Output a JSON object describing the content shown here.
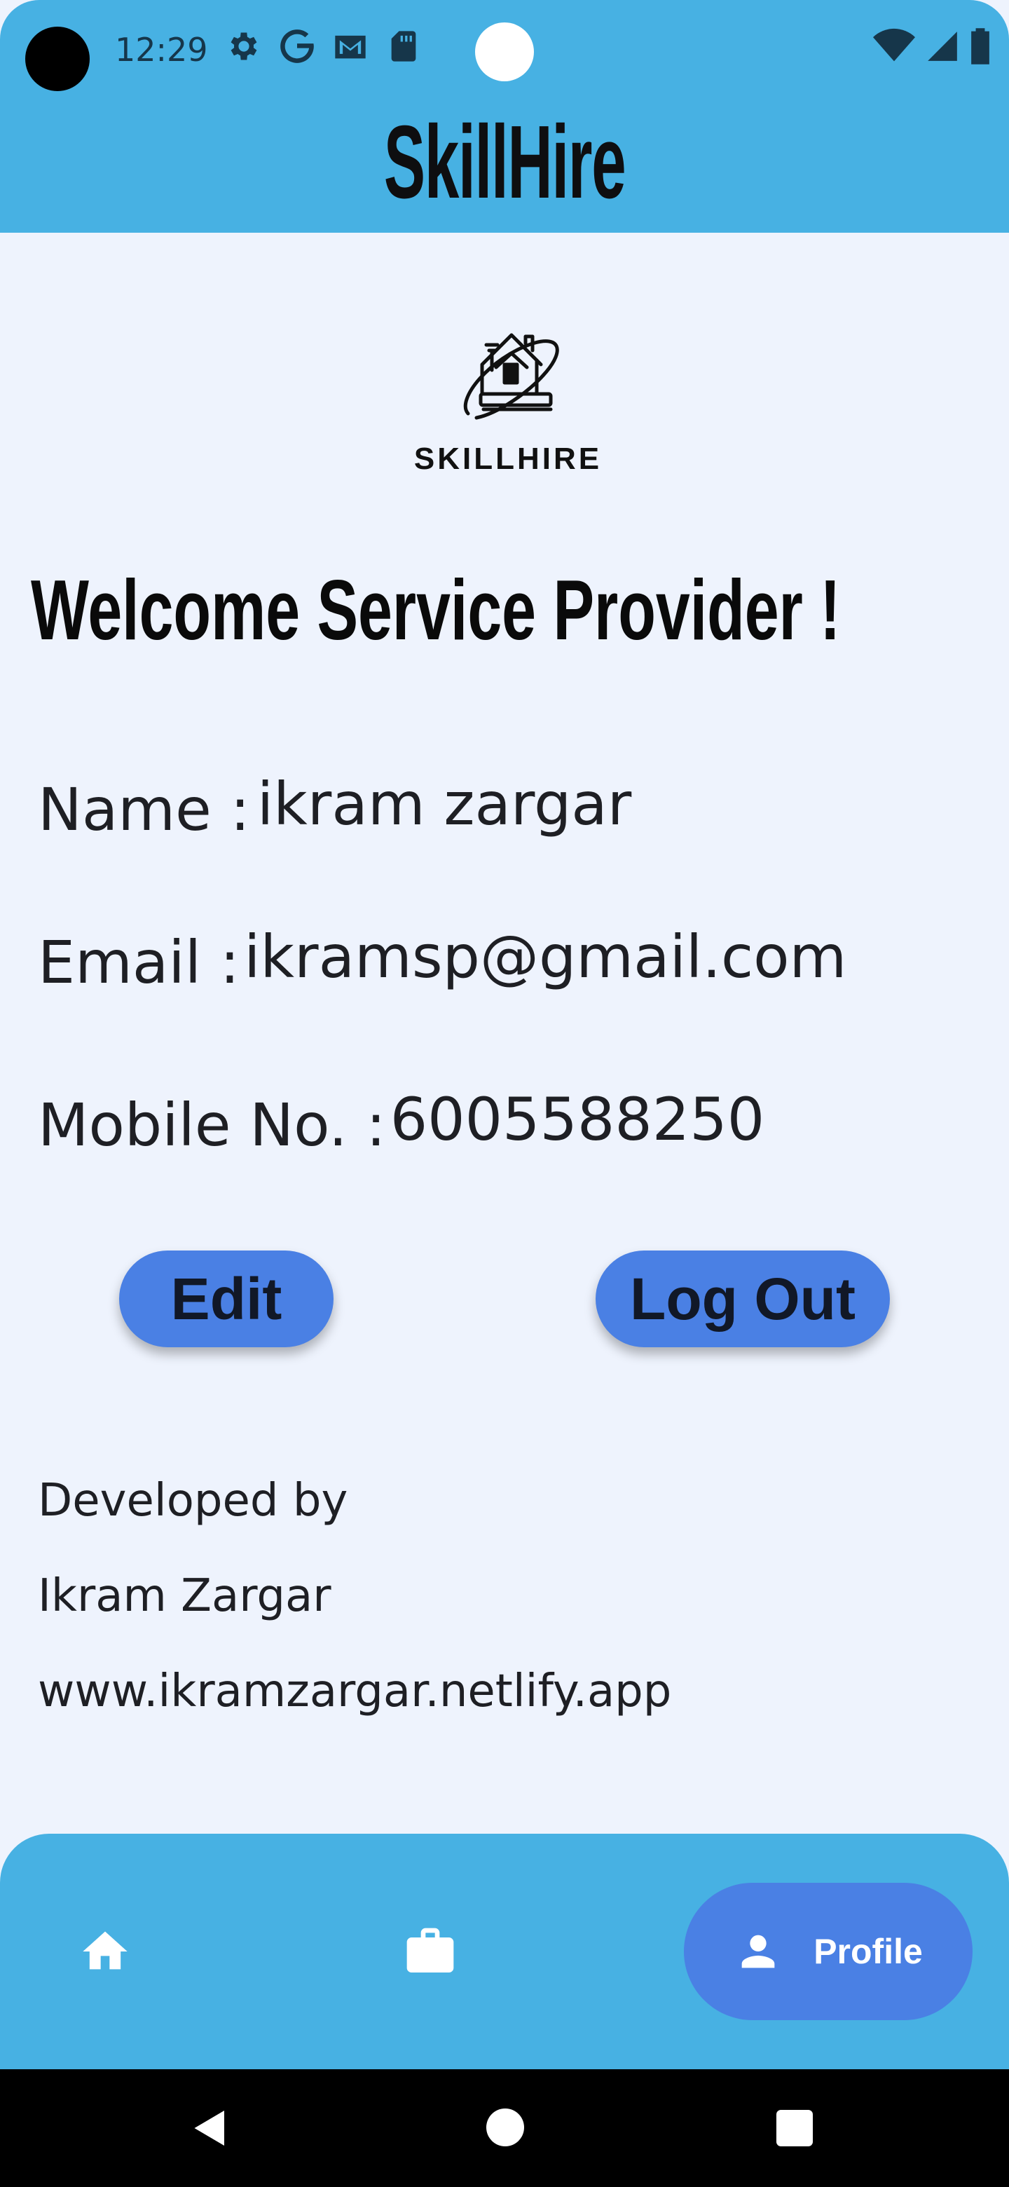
{
  "status_bar": {
    "time": "12:29",
    "icons": [
      "gear-icon",
      "google-g-icon",
      "gmail-icon",
      "sd-card-icon",
      "wifi-icon",
      "signal-icon",
      "battery-icon"
    ]
  },
  "app_bar": {
    "title": "SkillHire"
  },
  "logo": {
    "text": "SKILLHIRE"
  },
  "welcome": "Welcome Service Provider !",
  "profile": {
    "name_label": "Name : ",
    "name_value": "ikram zargar",
    "email_label": "Email : ",
    "email_value": "ikramsp@gmail.com",
    "mobile_label": "Mobile No. : ",
    "mobile_value": "6005588250"
  },
  "actions": {
    "edit": "Edit",
    "logout": "Log Out"
  },
  "developer": {
    "line1": "Developed by",
    "line2": "Ikram Zargar",
    "line3": "www.ikramzargar.netlify.app"
  },
  "bottom_nav": {
    "items": [
      {
        "icon": "home-icon",
        "label": ""
      },
      {
        "icon": "briefcase-icon",
        "label": ""
      },
      {
        "icon": "person-icon",
        "label": "Profile",
        "selected": true
      }
    ]
  },
  "colors": {
    "app_bar": "#47b1e3",
    "background": "#eef3fd",
    "button": "#4a80e4"
  }
}
